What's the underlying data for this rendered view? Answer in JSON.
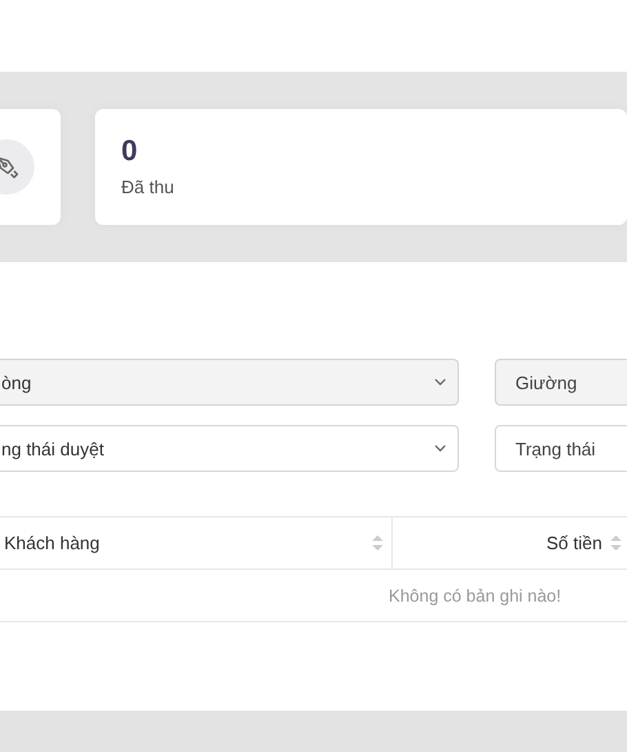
{
  "stat_cards": [
    {
      "kind": "icon"
    },
    {
      "kind": "value",
      "value": "0",
      "label": "Đã thu"
    }
  ],
  "filters": [
    {
      "kind": "select",
      "text": "òng",
      "disabled": true
    },
    {
      "kind": "input",
      "placeholder": "Giường",
      "disabled": true
    },
    {
      "kind": "select",
      "text": "ng thái duyệt",
      "disabled": false
    },
    {
      "kind": "input",
      "placeholder": "Trạng thái",
      "disabled": false
    }
  ],
  "table": {
    "columns": [
      {
        "label": "Khách hàng"
      },
      {
        "label": "Số tiền"
      }
    ],
    "empty_message": "Không có bản ghi nào!"
  }
}
